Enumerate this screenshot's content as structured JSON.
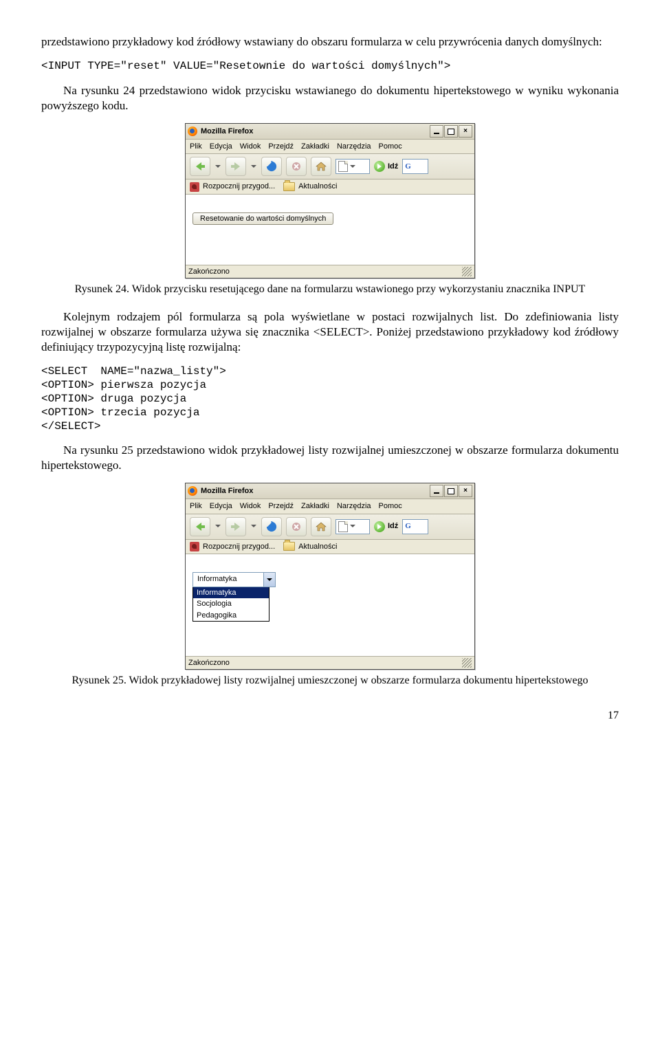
{
  "para_intro1": "przedstawiono przykładowy kod źródłowy wstawiany do obszaru formularza w celu przywrócenia danych domyślnych:",
  "code1": "<INPUT TYPE=\"reset\" VALUE=\"Resetownie do wartości domyślnych\">",
  "para_after_code1": "Na rysunku 24 przedstawiono widok przycisku wstawianego do dokumentu hipertekstowego w wyniku wykonania powyższego kodu.",
  "caption24": "Rysunek 24. Widok przycisku resetującego dane na formularzu wstawionego przy wykorzystaniu znacznika INPUT",
  "para_mid": "Kolejnym rodzajem pól formularza są pola wyświetlane w postaci rozwijalnych list. Do zdefiniowania listy rozwijalnej w obszarze formularza używa się znacznika <SELECT>. Poniżej przedstawiono przykładowy kod źródłowy definiujący trzypozycyjną listę rozwijalną:",
  "code2_l1": "<SELECT  NAME=\"nazwa_listy\">",
  "code2_l2": "<OPTION> pierwsza pozycja",
  "code2_l3": "<OPTION> druga pozycja",
  "code2_l4": "<OPTION> trzecia pozycja",
  "code2_l5": "</SELECT>",
  "para_after_code2": "Na rysunku 25 przedstawiono widok przykładowej listy rozwijalnej umieszczonej w obszarze formularza dokumentu hipertekstowego.",
  "caption25": "Rysunek 25. Widok przykładowej listy rozwijalnej umieszczonej w obszarze formularza dokumentu hipertekstowego",
  "page_number": "17",
  "ff_title": "Mozilla Firefox",
  "menu": {
    "plik": "Plik",
    "edycja": "Edycja",
    "widok": "Widok",
    "przejdz": "Przejdź",
    "zakladki": "Zakładki",
    "narzedzia": "Narzędzia",
    "pomoc": "Pomoc"
  },
  "go_label": "Idź",
  "google_g": "G",
  "bookmarks": {
    "rozpocznij": "Rozpocznij przygod...",
    "aktualnosci": "Aktualności"
  },
  "reset_button_label": "Resetowanie do wartości domyślnych",
  "status_done": "Zakończono",
  "select_visible": "Informatyka",
  "listbox": {
    "opt1": "Informatyka",
    "opt2": "Socjologia",
    "opt3": "Pedagogika"
  }
}
